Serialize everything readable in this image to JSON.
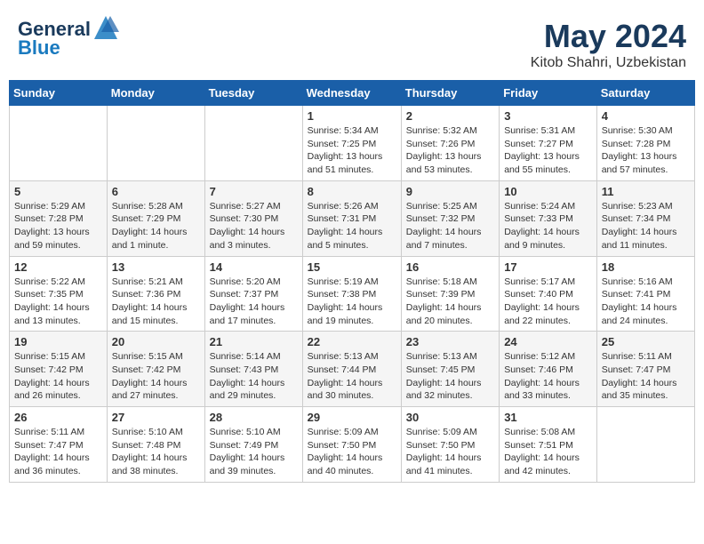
{
  "header": {
    "logo_line1": "General",
    "logo_line2": "Blue",
    "month": "May 2024",
    "location": "Kitob Shahri, Uzbekistan"
  },
  "weekdays": [
    "Sunday",
    "Monday",
    "Tuesday",
    "Wednesday",
    "Thursday",
    "Friday",
    "Saturday"
  ],
  "weeks": [
    [
      {
        "day": "",
        "info": ""
      },
      {
        "day": "",
        "info": ""
      },
      {
        "day": "",
        "info": ""
      },
      {
        "day": "1",
        "info": "Sunrise: 5:34 AM\nSunset: 7:25 PM\nDaylight: 13 hours\nand 51 minutes."
      },
      {
        "day": "2",
        "info": "Sunrise: 5:32 AM\nSunset: 7:26 PM\nDaylight: 13 hours\nand 53 minutes."
      },
      {
        "day": "3",
        "info": "Sunrise: 5:31 AM\nSunset: 7:27 PM\nDaylight: 13 hours\nand 55 minutes."
      },
      {
        "day": "4",
        "info": "Sunrise: 5:30 AM\nSunset: 7:28 PM\nDaylight: 13 hours\nand 57 minutes."
      }
    ],
    [
      {
        "day": "5",
        "info": "Sunrise: 5:29 AM\nSunset: 7:28 PM\nDaylight: 13 hours\nand 59 minutes."
      },
      {
        "day": "6",
        "info": "Sunrise: 5:28 AM\nSunset: 7:29 PM\nDaylight: 14 hours\nand 1 minute."
      },
      {
        "day": "7",
        "info": "Sunrise: 5:27 AM\nSunset: 7:30 PM\nDaylight: 14 hours\nand 3 minutes."
      },
      {
        "day": "8",
        "info": "Sunrise: 5:26 AM\nSunset: 7:31 PM\nDaylight: 14 hours\nand 5 minutes."
      },
      {
        "day": "9",
        "info": "Sunrise: 5:25 AM\nSunset: 7:32 PM\nDaylight: 14 hours\nand 7 minutes."
      },
      {
        "day": "10",
        "info": "Sunrise: 5:24 AM\nSunset: 7:33 PM\nDaylight: 14 hours\nand 9 minutes."
      },
      {
        "day": "11",
        "info": "Sunrise: 5:23 AM\nSunset: 7:34 PM\nDaylight: 14 hours\nand 11 minutes."
      }
    ],
    [
      {
        "day": "12",
        "info": "Sunrise: 5:22 AM\nSunset: 7:35 PM\nDaylight: 14 hours\nand 13 minutes."
      },
      {
        "day": "13",
        "info": "Sunrise: 5:21 AM\nSunset: 7:36 PM\nDaylight: 14 hours\nand 15 minutes."
      },
      {
        "day": "14",
        "info": "Sunrise: 5:20 AM\nSunset: 7:37 PM\nDaylight: 14 hours\nand 17 minutes."
      },
      {
        "day": "15",
        "info": "Sunrise: 5:19 AM\nSunset: 7:38 PM\nDaylight: 14 hours\nand 19 minutes."
      },
      {
        "day": "16",
        "info": "Sunrise: 5:18 AM\nSunset: 7:39 PM\nDaylight: 14 hours\nand 20 minutes."
      },
      {
        "day": "17",
        "info": "Sunrise: 5:17 AM\nSunset: 7:40 PM\nDaylight: 14 hours\nand 22 minutes."
      },
      {
        "day": "18",
        "info": "Sunrise: 5:16 AM\nSunset: 7:41 PM\nDaylight: 14 hours\nand 24 minutes."
      }
    ],
    [
      {
        "day": "19",
        "info": "Sunrise: 5:15 AM\nSunset: 7:42 PM\nDaylight: 14 hours\nand 26 minutes."
      },
      {
        "day": "20",
        "info": "Sunrise: 5:15 AM\nSunset: 7:42 PM\nDaylight: 14 hours\nand 27 minutes."
      },
      {
        "day": "21",
        "info": "Sunrise: 5:14 AM\nSunset: 7:43 PM\nDaylight: 14 hours\nand 29 minutes."
      },
      {
        "day": "22",
        "info": "Sunrise: 5:13 AM\nSunset: 7:44 PM\nDaylight: 14 hours\nand 30 minutes."
      },
      {
        "day": "23",
        "info": "Sunrise: 5:13 AM\nSunset: 7:45 PM\nDaylight: 14 hours\nand 32 minutes."
      },
      {
        "day": "24",
        "info": "Sunrise: 5:12 AM\nSunset: 7:46 PM\nDaylight: 14 hours\nand 33 minutes."
      },
      {
        "day": "25",
        "info": "Sunrise: 5:11 AM\nSunset: 7:47 PM\nDaylight: 14 hours\nand 35 minutes."
      }
    ],
    [
      {
        "day": "26",
        "info": "Sunrise: 5:11 AM\nSunset: 7:47 PM\nDaylight: 14 hours\nand 36 minutes."
      },
      {
        "day": "27",
        "info": "Sunrise: 5:10 AM\nSunset: 7:48 PM\nDaylight: 14 hours\nand 38 minutes."
      },
      {
        "day": "28",
        "info": "Sunrise: 5:10 AM\nSunset: 7:49 PM\nDaylight: 14 hours\nand 39 minutes."
      },
      {
        "day": "29",
        "info": "Sunrise: 5:09 AM\nSunset: 7:50 PM\nDaylight: 14 hours\nand 40 minutes."
      },
      {
        "day": "30",
        "info": "Sunrise: 5:09 AM\nSunset: 7:50 PM\nDaylight: 14 hours\nand 41 minutes."
      },
      {
        "day": "31",
        "info": "Sunrise: 5:08 AM\nSunset: 7:51 PM\nDaylight: 14 hours\nand 42 minutes."
      },
      {
        "day": "",
        "info": ""
      }
    ]
  ]
}
